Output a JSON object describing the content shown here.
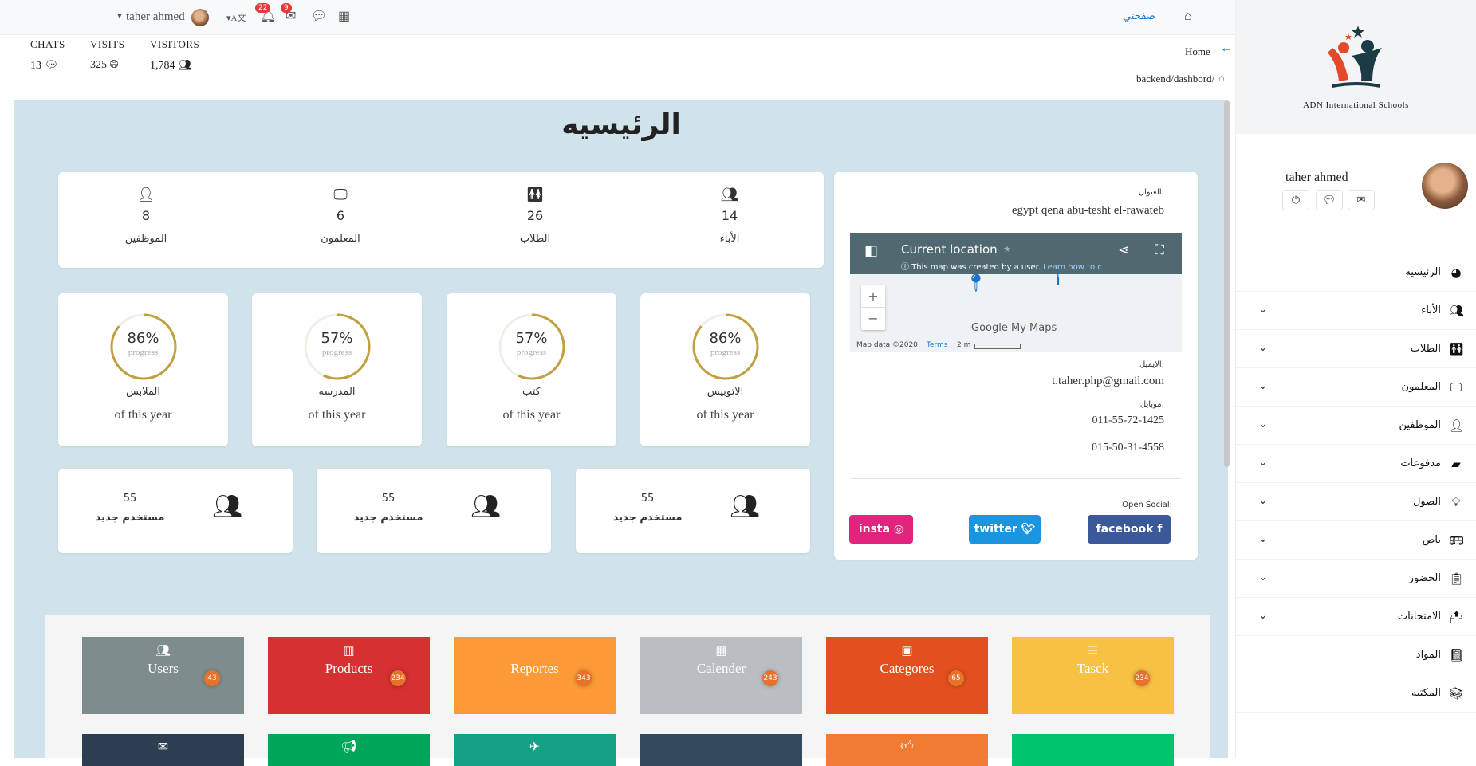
{
  "topbar": {
    "brand_label": "صفحتي",
    "user_name": "taher ahmed",
    "notif_count": "22",
    "mail_count": "9"
  },
  "stats": [
    {
      "label": "CHATS",
      "value": "13"
    },
    {
      "label": "VISITS",
      "value": "325"
    },
    {
      "label": "VISITORS",
      "value": "1,784"
    }
  ],
  "breadcrumb": {
    "home": "Home",
    "path": "backend/dashbord/"
  },
  "page_title": "الرئيسيه",
  "counts": [
    {
      "label": "الموظفين",
      "value": "8"
    },
    {
      "label": "المعلمون",
      "value": "6"
    },
    {
      "label": "الطلاب",
      "value": "26"
    },
    {
      "label": "الأباء",
      "value": "14"
    }
  ],
  "progress": [
    {
      "percent": 86,
      "percent_text": "86%",
      "sub": "progress",
      "label": "الملابس",
      "caption": "of this year"
    },
    {
      "percent": 57,
      "percent_text": "57%",
      "sub": "progress",
      "label": "المدرسه",
      "caption": "of this year"
    },
    {
      "percent": 57,
      "percent_text": "57%",
      "sub": "progress",
      "label": "كتب",
      "caption": "of this year"
    },
    {
      "percent": 86,
      "percent_text": "86%",
      "sub": "progress",
      "label": "الاتوبيس",
      "caption": "of this year"
    }
  ],
  "new_users": [
    {
      "value": "55",
      "label": "مستخدم جديد"
    },
    {
      "value": "55",
      "label": "مستخدم جديد"
    },
    {
      "value": "55",
      "label": "مستخدم جديد"
    }
  ],
  "contact": {
    "address_label": "العنوان:",
    "address": "egypt qena abu-tesht el-rawateb",
    "map": {
      "title": "Current location",
      "note": "This map was created by a user.",
      "learn": "Learn how to c",
      "brand": "Google My Maps",
      "data": "Map data ©2020",
      "terms": "Terms",
      "scale": "2 m",
      "zoom_in": "+",
      "zoom_out": "−"
    },
    "email_label": "الايميل:",
    "email": "t.taher.php@gmail.com",
    "mobile_label": "موبايل:",
    "phone1": "011-55-72-1425",
    "phone2": "015-50-31-4558",
    "social_label": "Open Social:",
    "social": {
      "facebook": "facebook",
      "twitter": "twitter",
      "insta": "insta"
    }
  },
  "tiles": [
    {
      "name": "Users",
      "count": "43",
      "color": "#7f8c8d",
      "icon": "users-icon"
    },
    {
      "name": "Products",
      "count": "234",
      "color": "#d63031",
      "icon": "barcode-icon"
    },
    {
      "name": "Reportes",
      "count": "343",
      "color": "#fd9a38",
      "icon": "none"
    },
    {
      "name": "Calender",
      "count": "243",
      "color": "#b8bec2",
      "icon": "calendar-icon"
    },
    {
      "name": "Categores",
      "count": "65",
      "color": "#e1501e",
      "icon": "archive-icon"
    },
    {
      "name": "Tasck",
      "count": "234",
      "color": "#f7c244",
      "icon": "list-icon"
    }
  ],
  "tiles_row2": [
    {
      "color": "#2c3e50",
      "icon": "envelope-icon"
    },
    {
      "color": "#00a65a",
      "icon": "bullhorn-icon"
    },
    {
      "color": "#16a085",
      "icon": "plane-icon"
    },
    {
      "color": "#34495e",
      "icon": "none"
    },
    {
      "color": "#f07b33",
      "icon": "thumbs-up-icon"
    },
    {
      "color": "#00c46e",
      "icon": "none"
    }
  ],
  "sidebar": {
    "school_name": "ADN International Schools",
    "profile_name": "taher ahmed",
    "items": [
      {
        "label": "الرئيسيه"
      },
      {
        "label": "الأباء"
      },
      {
        "label": "الطلاب"
      },
      {
        "label": "المعلمون"
      },
      {
        "label": "الموظفين"
      },
      {
        "label": "مدفوعات"
      },
      {
        "label": "الصول"
      },
      {
        "label": "باص"
      },
      {
        "label": "الحضور"
      },
      {
        "label": "الامتحانات"
      },
      {
        "label": "المواد"
      },
      {
        "label": "المكتبه"
      }
    ]
  }
}
